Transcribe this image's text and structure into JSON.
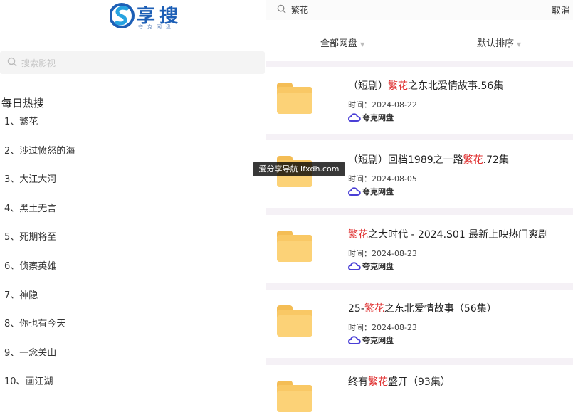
{
  "logo": {
    "brand": "享搜",
    "tagline": "夸克网盘",
    "color": "#1d5fb6"
  },
  "left_search": {
    "placeholder": "搜索影视"
  },
  "hot": {
    "title": "每日热搜",
    "items": [
      "1、繁花",
      "2、涉过愤怒的海",
      "3、大江大河",
      "4、黑土无言",
      "5、死期将至",
      "6、侦察英雄",
      "7、神隐",
      "8、你也有今天",
      "9、一念关山",
      "10、画江湖"
    ]
  },
  "search": {
    "query": "繁花",
    "cancel_label": "取消"
  },
  "filters": {
    "disk_label": "全部网盘",
    "sort_label": "默认排序"
  },
  "results": [
    {
      "pre": "（短剧）",
      "hl": "繁花",
      "post": "之东北爱情故事.56集",
      "time": "时间：2024-08-22",
      "source": "夸克网盘"
    },
    {
      "pre": "（短剧）回档1989之一路",
      "hl": "繁花",
      "post": ".72集",
      "time": "时间：2024-08-05",
      "source": "夸克网盘"
    },
    {
      "pre": "",
      "hl": "繁花",
      "post": "之大时代 - 2024.S01 最新上映热门爽剧",
      "time": "时间：2024-08-23",
      "source": "夸克网盘"
    },
    {
      "pre": "25-",
      "hl": "繁花",
      "post": "之东北爱情故事（56集）",
      "time": "时间：2024-08-23",
      "source": "夸克网盘"
    },
    {
      "pre": "终有",
      "hl": "繁花",
      "post": "盛开（93集）",
      "time": "",
      "source": ""
    }
  ],
  "watermark": "爱分享导航 ifxdh.com",
  "colors": {
    "highlight": "#e03030",
    "folder": "#f9c865",
    "quark": "#4a3fd6"
  }
}
